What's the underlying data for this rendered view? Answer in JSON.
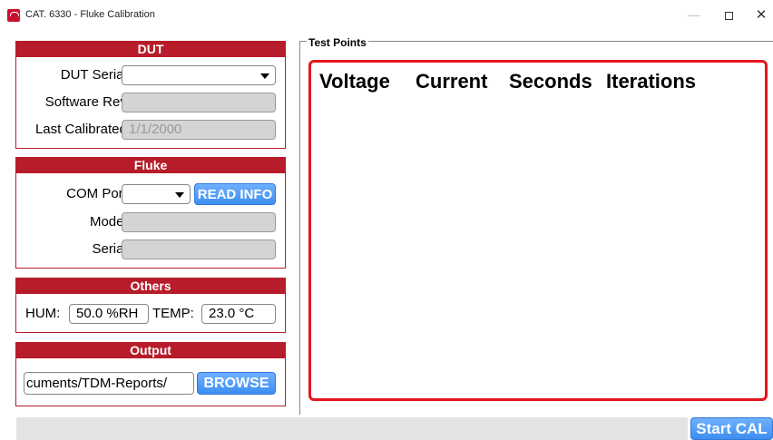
{
  "window": {
    "title": "CAT. 6330 - Fluke Calibration",
    "minimize_glyph": "—",
    "close_glyph": "✕"
  },
  "dut": {
    "header": "DUT",
    "serial_label": "DUT Serial:",
    "serial_value": "",
    "software_label": "Software Rev:",
    "software_value": "",
    "calibrated_label": "Last Calibrated:",
    "calibrated_value": "1/1/2000"
  },
  "fluke": {
    "header": "Fluke",
    "com_label": "COM Port:",
    "com_value": "",
    "read_button": "READ INFO",
    "model_label": "Model:",
    "model_value": "",
    "serial_label": "Serial:",
    "serial_value": ""
  },
  "others": {
    "header": "Others",
    "hum_label": "HUM:",
    "hum_value": "50.0 %RH",
    "temp_label": "TEMP:",
    "temp_value": "23.0 °C"
  },
  "output": {
    "header": "Output",
    "path_value": "cuments/TDM-Reports/",
    "browse_button": "BROWSE"
  },
  "test_points": {
    "legend": "Test Points",
    "columns": [
      "Voltage",
      "Current",
      "Seconds",
      "Iterations"
    ]
  },
  "actions": {
    "start_button": "Start CAL"
  }
}
